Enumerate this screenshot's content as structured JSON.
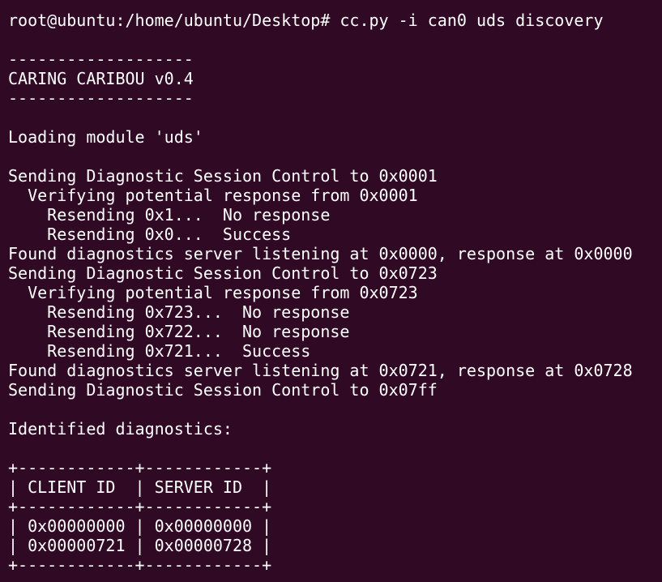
{
  "terminal": {
    "lines": [
      "root@ubuntu:/home/ubuntu/Desktop# cc.py -i can0 uds discovery",
      "",
      "-------------------",
      "CARING CARIBOU v0.4",
      "-------------------",
      "",
      "Loading module 'uds'",
      "",
      "Sending Diagnostic Session Control to 0x0001",
      "  Verifying potential response from 0x0001",
      "    Resending 0x1...  No response",
      "    Resending 0x0...  Success",
      "Found diagnostics server listening at 0x0000, response at 0x0000",
      "Sending Diagnostic Session Control to 0x0723",
      "  Verifying potential response from 0x0723",
      "    Resending 0x723...  No response",
      "    Resending 0x722...  No response",
      "    Resending 0x721...  Success",
      "Found diagnostics server listening at 0x0721, response at 0x0728",
      "Sending Diagnostic Session Control to 0x07ff",
      "",
      "Identified diagnostics:",
      "",
      "+------------+------------+",
      "| CLIENT ID  | SERVER ID  |",
      "+------------+------------+",
      "| 0x00000000 | 0x00000000 |",
      "| 0x00000721 | 0x00000728 |",
      "+------------+------------+"
    ]
  },
  "colors": {
    "background": "#300a24",
    "text": "#ffffff"
  }
}
